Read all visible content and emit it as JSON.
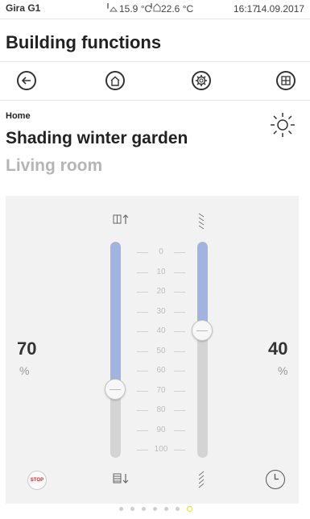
{
  "status_bar": {
    "device": "Gira G1",
    "temp_outdoor": "15.9 °C",
    "temp_indoor": "22.6 °C",
    "time": "16:17",
    "date": "14.09.2017"
  },
  "header": {
    "title": "Building functions"
  },
  "nav": {
    "buttons": [
      {
        "name": "back",
        "icon": "arrow-left-icon"
      },
      {
        "name": "home",
        "icon": "home-icon"
      },
      {
        "name": "settings",
        "icon": "gear-icon"
      },
      {
        "name": "grid",
        "icon": "grid-icon"
      }
    ]
  },
  "function": {
    "breadcrumb": "Home",
    "name": "Shading winter garden",
    "room": "Living room",
    "icon": "sun-icon"
  },
  "control": {
    "position": {
      "value": "70",
      "unit": "%",
      "level": 70
    },
    "slat": {
      "value": "40",
      "unit": "%",
      "level": 40
    },
    "scale": [
      "0",
      "10",
      "20",
      "30",
      "40",
      "50",
      "60",
      "70",
      "80",
      "90",
      "100"
    ],
    "stop_label": "STOP",
    "colors": {
      "fill": "#a2b3e0",
      "track": "#d4d4d4",
      "stop": "#d02020"
    }
  },
  "pager": {
    "count": 7,
    "active_index": 6,
    "active_color": "#d8e63a"
  }
}
